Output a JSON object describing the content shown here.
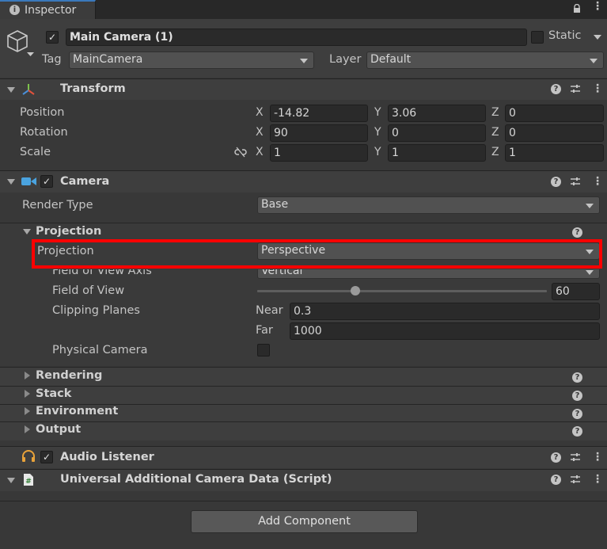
{
  "tab": {
    "label": "Inspector"
  },
  "object": {
    "name": "Main Camera (1)",
    "static_label": "Static",
    "tag_label": "Tag",
    "tag_value": "MainCamera",
    "layer_label": "Layer",
    "layer_value": "Default"
  },
  "transform": {
    "title": "Transform",
    "position_label": "Position",
    "rotation_label": "Rotation",
    "scale_label": "Scale",
    "position": {
      "x": "-14.82",
      "y": "3.06",
      "z": "0"
    },
    "rotation": {
      "x": "90",
      "y": "0",
      "z": "0"
    },
    "scale": {
      "x": "1",
      "y": "1",
      "z": "1"
    },
    "axis_x": "X",
    "axis_y": "Y",
    "axis_z": "Z"
  },
  "camera": {
    "title": "Camera",
    "render_type_label": "Render Type",
    "render_type_value": "Base",
    "projection_section": "Projection",
    "projection_label": "Projection",
    "projection_value": "Perspective",
    "fov_axis_label": "Field of View Axis",
    "fov_axis_value": "Vertical",
    "fov_label": "Field of View",
    "fov_value": "60",
    "fov_slider_fraction": 0.34,
    "clipping_label": "Clipping Planes",
    "near_label": "Near",
    "near_value": "0.3",
    "far_label": "Far",
    "far_value": "1000",
    "physical_label": "Physical Camera",
    "sections": {
      "rendering": "Rendering",
      "stack": "Stack",
      "environment": "Environment",
      "output": "Output"
    }
  },
  "audio_listener": {
    "title": "Audio Listener"
  },
  "script_component": {
    "title": "Universal Additional Camera Data (Script)"
  },
  "add_component": {
    "label": "Add Component"
  },
  "colors": {
    "highlight": "#ff0000",
    "tab_accent": "#3a79bb"
  }
}
